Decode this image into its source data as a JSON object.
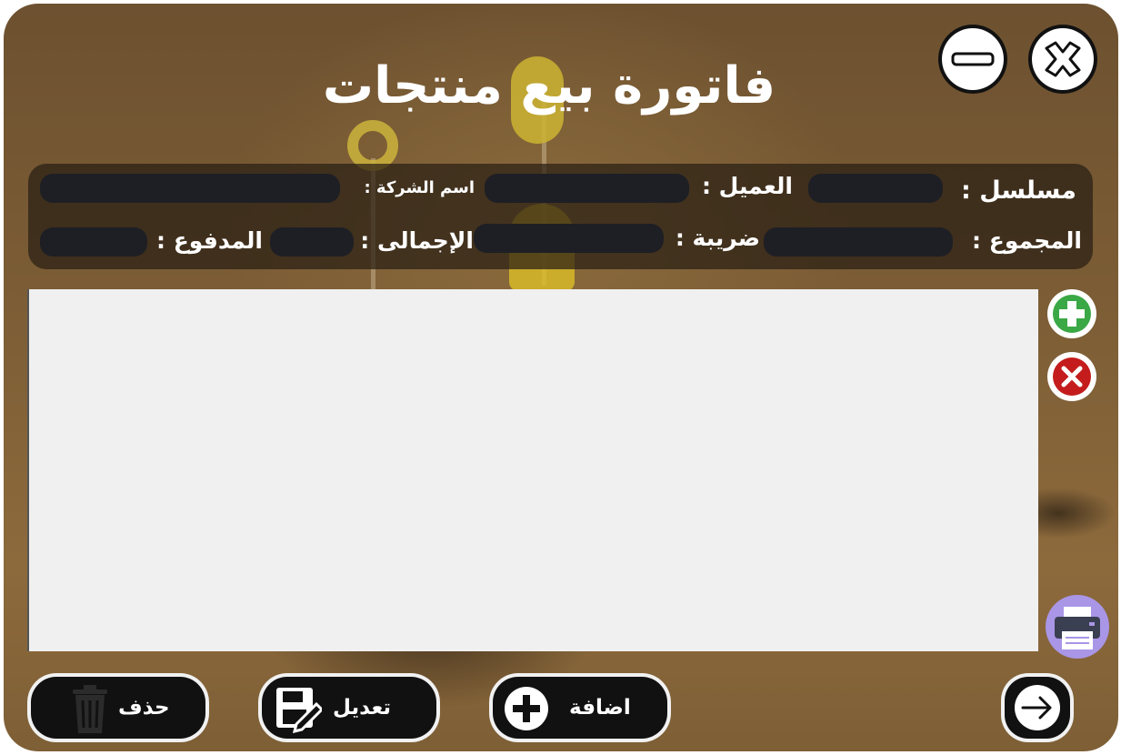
{
  "window": {
    "title": "فاتورة بيع منتجات"
  },
  "header_buttons": {
    "minimize": "minimize-icon",
    "close": "close-icon"
  },
  "fields": {
    "serial_label": "مسلسل :",
    "customer_label": "العميل :",
    "company_label": "اسم الشركة :",
    "sum_label": "المجموع :",
    "tax_label": "ضريبة :",
    "total_label": "الإجمالى :",
    "paid_label": "المدفوع :",
    "serial_value": "",
    "customer_value": "",
    "company_value": "",
    "sum_value": "",
    "tax_value": "",
    "total_value": "",
    "paid_value": ""
  },
  "toolbar": {
    "delete_label": "حذف",
    "edit_label": "تعديل",
    "add_label": "اضافة"
  },
  "icons": {
    "add_row": "plus-circle-icon",
    "remove_row": "x-circle-icon",
    "print": "printer-icon",
    "next": "arrow-right-icon",
    "trash": "trash-icon",
    "edit": "edit-icon",
    "add": "plus-icon"
  },
  "colors": {
    "title": "#ffffff",
    "panel": "#2a1e14",
    "field": "#1e1f25",
    "grid": "#f0f0f0",
    "green": "#3aa845",
    "red": "#c41c1c",
    "print_bg": "#a996e6"
  }
}
